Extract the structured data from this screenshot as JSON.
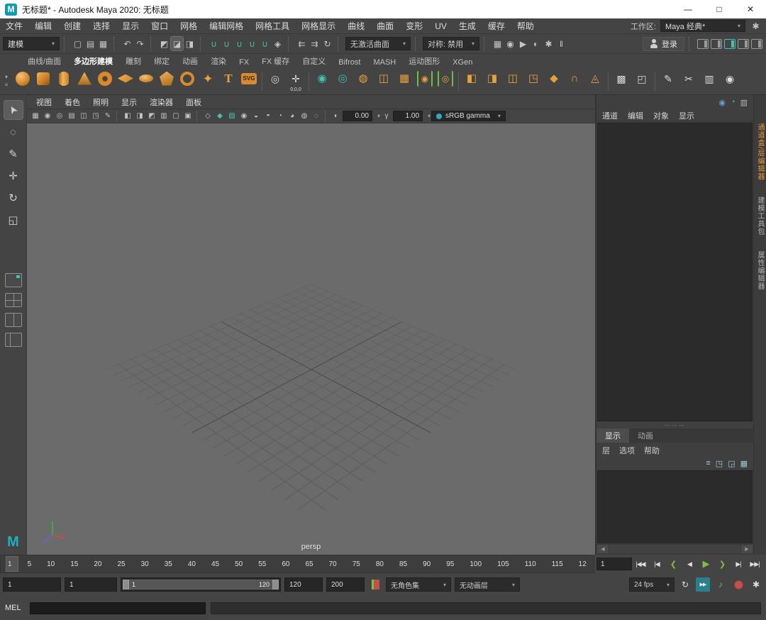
{
  "ui": {
    "caret": "▾",
    "splitter_dots": "⋯⋯⋯"
  },
  "title_bar": {
    "logo_letter": "M",
    "app_title": "无标题* - Autodesk Maya 2020: 无标题",
    "minimize_glyph": "—",
    "maximize_glyph": "□",
    "close_glyph": "✕"
  },
  "menu_bar": {
    "items": [
      "文件",
      "编辑",
      "创建",
      "选择",
      "显示",
      "窗口",
      "网格",
      "编辑网格",
      "网格工具",
      "网格显示",
      "曲线",
      "曲面",
      "变形",
      "UV",
      "生成",
      "缓存",
      "帮助"
    ],
    "workspace_label": "工作区:",
    "workspace_value": "Maya 经典*",
    "workspace_icon_glyph": "✱"
  },
  "status_line": {
    "mode_value": "建模",
    "file_icons": [
      {
        "name": "new-scene-icon",
        "glyph": "▢"
      },
      {
        "name": "open-scene-icon",
        "glyph": "▤"
      },
      {
        "name": "save-scene-icon",
        "glyph": "▦"
      }
    ],
    "undo_icons": [
      {
        "name": "undo-icon",
        "glyph": "↶"
      },
      {
        "name": "redo-icon",
        "glyph": "↷"
      }
    ],
    "selection_icons": [
      {
        "name": "select-by-hierarchy-icon",
        "glyph": "◩"
      },
      {
        "name": "select-by-object-icon",
        "glyph": "◪",
        "cls": "active"
      },
      {
        "name": "select-by-component-icon",
        "glyph": "◨"
      }
    ],
    "snap_icons": [
      {
        "name": "snap-to-grid-icon",
        "glyph": "∪",
        "cls": "teal"
      },
      {
        "name": "snap-to-curve-icon",
        "glyph": "∪",
        "cls": "teal"
      },
      {
        "name": "snap-to-point-icon",
        "glyph": "∪",
        "cls": "teal"
      },
      {
        "name": "snap-to-projected-center-icon",
        "glyph": "∪",
        "cls": "teal"
      },
      {
        "name": "snap-to-view-plane-icon",
        "glyph": "∪",
        "cls": "teal"
      },
      {
        "name": "make-live-icon",
        "glyph": "◈"
      }
    ],
    "history_icons": [
      {
        "name": "input-connections-icon",
        "glyph": "⇇"
      },
      {
        "name": "output-connections-icon",
        "glyph": "⇉"
      },
      {
        "name": "construction-history-icon",
        "glyph": "↻"
      }
    ],
    "surface_field_value": "无激活曲面",
    "symmetry_field_value": "对称: 禁用",
    "render_icons": [
      {
        "name": "render-current-frame-icon",
        "glyph": "▦"
      },
      {
        "name": "ipr-render-icon",
        "glyph": "◉"
      },
      {
        "name": "render-sequence-icon",
        "glyph": "▶"
      },
      {
        "name": "light-editor-icon",
        "glyph": "◐"
      },
      {
        "name": "render-settings-icon",
        "glyph": "✱"
      },
      {
        "name": "pause-icon",
        "glyph": "‖"
      }
    ],
    "login_label": "登录",
    "sidebar_toggles": [
      {
        "name": "attribute-editor-toggle"
      },
      {
        "name": "tool-settings-toggle"
      },
      {
        "name": "channel-box-toggle",
        "cls": "active"
      },
      {
        "name": "modeling-toolkit-toggle"
      },
      {
        "name": "outliner-toggle"
      }
    ]
  },
  "shelf": {
    "ctl_caret": "▾",
    "ctl_menu": "≡",
    "tabs": [
      {
        "label": "曲线/曲面"
      },
      {
        "label": "多边形建模",
        "cls": "active"
      },
      {
        "label": "雕刻"
      },
      {
        "label": "绑定"
      },
      {
        "label": "动画"
      },
      {
        "label": "渲染"
      },
      {
        "label": "FX"
      },
      {
        "label": "FX 缓存"
      },
      {
        "label": "自定义"
      },
      {
        "label": "Bifrost"
      },
      {
        "label": "MASH"
      },
      {
        "label": "运动图形"
      },
      {
        "label": "XGen"
      }
    ],
    "primitives": [
      {
        "name": "poly-sphere-icon",
        "shape": "shp-sphere"
      },
      {
        "name": "poly-cube-icon",
        "shape": "shp-cube"
      },
      {
        "name": "poly-cylinder-icon",
        "shape": "shp-cylinder"
      },
      {
        "name": "poly-cone-icon",
        "shape": "shp-cone"
      },
      {
        "name": "poly-torus-icon",
        "shape": "shp-torus"
      },
      {
        "name": "poly-plane-icon",
        "shape": "shp-plane"
      },
      {
        "name": "poly-disc-icon",
        "shape": "shp-disc"
      },
      {
        "name": "poly-platonic-icon",
        "shape": "shp-platonic"
      },
      {
        "name": "poly-pipe-icon",
        "shape": "shp-pipe"
      },
      {
        "name": "poly-superellipse-icon",
        "shape": "shp-star",
        "glyph": "✦"
      },
      {
        "name": "poly-type-icon",
        "shape": "shp-type",
        "glyph": "T"
      },
      {
        "name": "poly-svg-icon",
        "shape": "shp-svg",
        "glyph": "SVG"
      }
    ],
    "pivot_tools": [
      {
        "name": "zoom-selected-icon",
        "shape": "shp-tool",
        "glyph": "◎"
      },
      {
        "name": "move-pivot-to-origin-icon",
        "shape": "shp-tool",
        "glyph": "✛",
        "caption": "0,0,0"
      }
    ],
    "mesh_tools": [
      {
        "name": "combine-icon",
        "shape": "shp-teal",
        "glyph": "◉"
      },
      {
        "name": "separate-icon",
        "shape": "shp-teal",
        "glyph": "◎"
      },
      {
        "name": "smooth-icon",
        "shape": "shp-orange-g",
        "glyph": "◍"
      },
      {
        "name": "mirror-icon",
        "shape": "shp-orange-g",
        "glyph": "◫"
      },
      {
        "name": "remesh-icon",
        "shape": "shp-orange-g",
        "glyph": "▦"
      },
      {
        "name": "smooth-mesh-preview-icon",
        "shape": "shp-bracket",
        "glyph": "◉"
      },
      {
        "name": "smooth-mesh-cage-icon",
        "shape": "shp-bracket",
        "glyph": "◎"
      }
    ],
    "boolean_tools": [
      {
        "name": "boolean-union-icon",
        "shape": "shp-orange-g",
        "glyph": "◧"
      },
      {
        "name": "boolean-difference-icon",
        "shape": "shp-orange-g",
        "glyph": "◨"
      },
      {
        "name": "boolean-intersection-icon",
        "shape": "shp-orange-g",
        "glyph": "◫"
      },
      {
        "name": "extrude-icon",
        "shape": "shp-orange-g",
        "glyph": "◳"
      },
      {
        "name": "bevel-icon",
        "shape": "shp-orange-g",
        "glyph": "◆"
      },
      {
        "name": "bridge-icon",
        "shape": "shp-orange-g",
        "glyph": "∩"
      },
      {
        "name": "append-to-polygon-icon",
        "shape": "shp-orange-g",
        "glyph": "◬"
      }
    ],
    "deform_tools": [
      {
        "name": "lattice-icon",
        "shape": "shp-tool",
        "glyph": "▩"
      },
      {
        "name": "wrap-deformer-icon",
        "shape": "shp-tool",
        "glyph": "◰"
      }
    ],
    "modeling_tools": [
      {
        "name": "quad-draw-icon",
        "shape": "shp-white",
        "glyph": "✎"
      },
      {
        "name": "multi-cut-icon",
        "shape": "shp-white",
        "glyph": "✂"
      },
      {
        "name": "insert-edge-loop-icon",
        "shape": "shp-white",
        "glyph": "▥"
      },
      {
        "name": "target-weld-icon",
        "shape": "shp-white",
        "glyph": "◉"
      }
    ]
  },
  "toolbox": {
    "tools": [
      {
        "name": "select-tool",
        "glyph": "➤",
        "cls": "active",
        "gcls": "rot-sel"
      },
      {
        "name": "lasso-select-tool",
        "glyph": "◌"
      },
      {
        "name": "paint-select-tool",
        "glyph": "✎"
      },
      {
        "name": "move-tool",
        "glyph": "✛"
      },
      {
        "name": "rotate-tool",
        "glyph": "↻"
      },
      {
        "name": "scale-tool",
        "glyph": "◱"
      }
    ],
    "layouts": [
      {
        "name": "single-pane-layout-button",
        "cls": "lay-single"
      },
      {
        "name": "four-pane-layout-button",
        "cls": "lay-four"
      },
      {
        "name": "two-pane-layout-button",
        "cls": "lay-two"
      },
      {
        "name": "outliner-persp-layout-button",
        "cls": "lay-outl"
      }
    ]
  },
  "viewport": {
    "menu": [
      "视图",
      "着色",
      "照明",
      "显示",
      "渲染器",
      "面板"
    ],
    "toolbar_icons_a": [
      {
        "name": "select-camera-icon",
        "glyph": "▦"
      },
      {
        "name": "lock-camera-icon",
        "glyph": "◉"
      },
      {
        "name": "camera-attributes-icon",
        "glyph": "◎"
      },
      {
        "name": "bookmarks-icon",
        "glyph": "▤"
      },
      {
        "name": "image-plane-icon",
        "glyph": "◫"
      },
      {
        "name": "2d-pan-zoom-icon",
        "glyph": "◳"
      },
      {
        "name": "grease-pencil-icon",
        "glyph": "✎"
      }
    ],
    "toolbar_icons_b": [
      {
        "name": "film-gate-icon",
        "glyph": "◧"
      },
      {
        "name": "resolution-gate-icon",
        "glyph": "◨"
      },
      {
        "name": "gate-mask-icon",
        "glyph": "◩"
      },
      {
        "name": "field-chart-icon",
        "glyph": "▥"
      },
      {
        "name": "safe-action-icon",
        "glyph": "▢"
      },
      {
        "name": "safe-title-icon",
        "glyph": "▣"
      }
    ],
    "toolbar_icons_c": [
      {
        "name": "wireframe-icon",
        "glyph": "◇"
      },
      {
        "name": "smooth-shade-all-icon",
        "glyph": "◆",
        "cls": "teal"
      },
      {
        "name": "textured-icon",
        "glyph": "▨",
        "cls": "teal"
      },
      {
        "name": "use-all-lights-icon",
        "glyph": "◉"
      },
      {
        "name": "shadows-icon",
        "glyph": "◒"
      },
      {
        "name": "screen-space-ao-icon",
        "glyph": "◓"
      },
      {
        "name": "motion-blur-icon",
        "glyph": "◔"
      },
      {
        "name": "multisample-aa-icon",
        "glyph": "◕"
      },
      {
        "name": "xray-icon",
        "glyph": "◍"
      },
      {
        "name": "isolate-select-icon",
        "glyph": "◌"
      }
    ],
    "exposure_icon_glyph": "◐",
    "exposure_value": "0.00",
    "gamma_icon_glyph": "γ",
    "gamma_value": "1.00",
    "colorspace_value": "sRGB gamma",
    "camera_label": "persp"
  },
  "right_panel": {
    "eval_icons": [
      {
        "name": "rig-evaluation-icon",
        "glyph": "◉",
        "cls": "blue"
      },
      {
        "name": "evaluation-mode-icon",
        "glyph": "◔",
        "cls": "teal"
      },
      {
        "name": "profiler-icon",
        "glyph": "▥",
        "cls": "gray"
      }
    ],
    "menu_tabs": [
      "通道",
      "编辑",
      "对象",
      "显示"
    ],
    "layer_tabs": [
      {
        "label": "显示",
        "cls": "active"
      },
      {
        "label": "动画"
      }
    ],
    "layer_menu": [
      "层",
      "选项",
      "帮助"
    ],
    "layer_icons": [
      {
        "name": "sort-layers-icon",
        "glyph": "≡"
      },
      {
        "name": "new-empty-layer-icon",
        "glyph": "◳"
      },
      {
        "name": "new-layer-from-selected-icon",
        "glyph": "◲"
      },
      {
        "name": "layer-options-icon",
        "glyph": "▦"
      }
    ],
    "hscroll_left": "◀",
    "hscroll_right": "▶",
    "vertical_tabs": [
      {
        "label": "通道盒/层编辑器",
        "cls": "active"
      },
      {
        "label": "建模工具包"
      },
      {
        "label": "属性编辑器"
      }
    ]
  },
  "time_slider": {
    "ticks": [
      "1",
      "5",
      "10",
      "15",
      "20",
      "25",
      "30",
      "35",
      "40",
      "45",
      "50",
      "55",
      "60",
      "65",
      "70",
      "75",
      "80",
      "85",
      "90",
      "95",
      "100",
      "105",
      "110",
      "115",
      "12"
    ],
    "frame_field_value": "1",
    "playback_buttons": [
      {
        "name": "go-to-playback-start-button",
        "glyph": "|◀◀"
      },
      {
        "name": "step-back-frame-button",
        "glyph": "|◀"
      },
      {
        "name": "step-back-key-button",
        "glyph": "❮",
        "cls": "key"
      },
      {
        "name": "play-backwards-button",
        "glyph": "◀"
      },
      {
        "name": "play-forwards-button",
        "glyph": "▶",
        "cls": "play"
      },
      {
        "name": "step-forward-key-button",
        "glyph": "❯",
        "cls": "key"
      },
      {
        "name": "step-forward-frame-button",
        "glyph": "▶|"
      },
      {
        "name": "go-to-playback-end-button",
        "glyph": "▶▶|"
      }
    ]
  },
  "range_slider": {
    "animation_start_value": "1",
    "playback_start_value": "1",
    "range_start_label": "1",
    "range_end_label": "120",
    "playback_end_value": "120",
    "animation_end_value": "200",
    "character_set_value": "无角色集",
    "anim_layer_value": "无动画层",
    "fps_value": "24 fps",
    "loop_glyph": "↻",
    "cached_playback_glyph": "▶▶",
    "sound_glyph": "♪",
    "preferences_glyph": "✱"
  },
  "command_line": {
    "label": "MEL"
  }
}
